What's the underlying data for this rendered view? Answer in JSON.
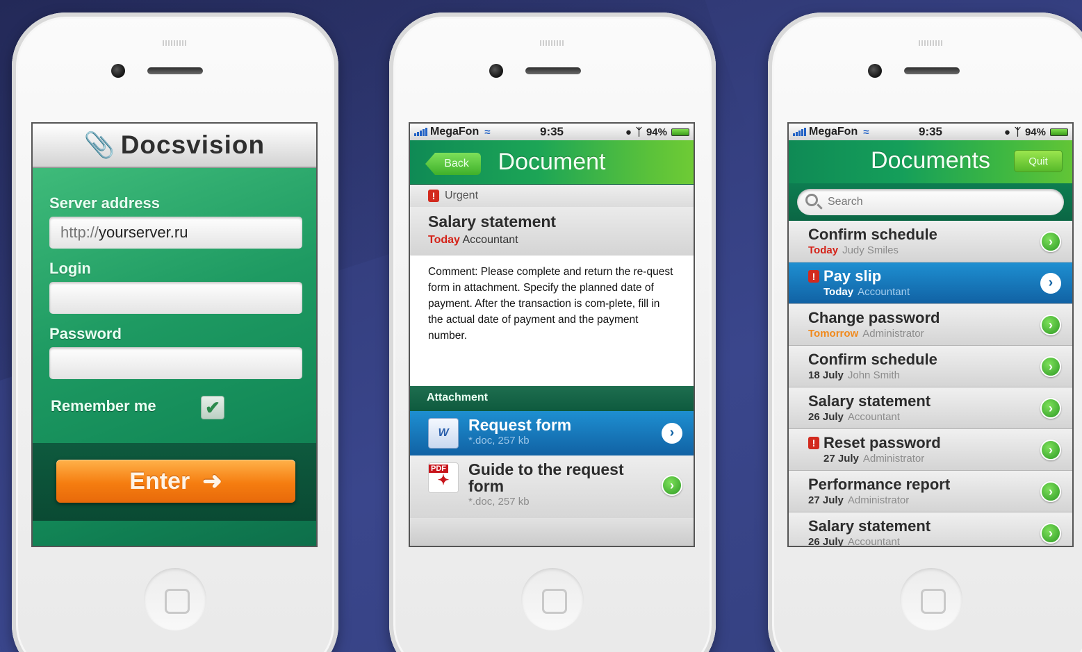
{
  "status": {
    "carrier": "MegaFon",
    "time": "9:35",
    "battery": "94%"
  },
  "login": {
    "brand": "Docsvision",
    "server_label": "Server address",
    "server_prefix": "http://",
    "server_value": "yourserver.ru",
    "login_label": "Login",
    "login_value": "",
    "password_label": "Password",
    "password_value": "",
    "remember_label": "Remember me",
    "remember_checked": true,
    "enter_label": "Enter"
  },
  "document": {
    "nav_title": "Document",
    "back_label": "Back",
    "urgent_label": "Urgent",
    "title": "Salary statement",
    "date": "Today",
    "author": "Accountant",
    "comment": "Comment: Please complete and return the re-quest form in attachment. Specify the planned date of payment. After the transaction is com-plete, fill in the actual date of payment and the payment number.",
    "attachment_header": "Attachment",
    "attachments": [
      {
        "title": "Request form",
        "meta": "*.doc, 257 kb",
        "icon": "word-icon",
        "selected": true
      },
      {
        "title": "Guide to the request form",
        "meta": "*.doc, 257 kb",
        "icon": "pdf-icon",
        "selected": false
      }
    ]
  },
  "documents": {
    "nav_title": "Documents",
    "quit_label": "Quit",
    "search_placeholder": "Search",
    "items": [
      {
        "title": "Confirm schedule",
        "date": "Today",
        "author": "Judy Smiles",
        "urgent": false,
        "date_color": "red",
        "selected": false
      },
      {
        "title": "Pay slip",
        "date": "Today",
        "author": "Accountant",
        "urgent": true,
        "date_color": "white",
        "selected": true
      },
      {
        "title": "Change password",
        "date": "Tomorrow",
        "author": "Administrator",
        "urgent": false,
        "date_color": "orange",
        "selected": false
      },
      {
        "title": "Confirm schedule",
        "date": "18 July",
        "author": "John Smith",
        "urgent": false,
        "date_color": "dark",
        "selected": false
      },
      {
        "title": "Salary statement",
        "date": "26 July",
        "author": "Accountant",
        "urgent": false,
        "date_color": "dark",
        "selected": false
      },
      {
        "title": "Reset password",
        "date": "27 July",
        "author": "Administrator",
        "urgent": true,
        "date_color": "dark",
        "selected": false
      },
      {
        "title": "Performance report",
        "date": "27 July",
        "author": "Administrator",
        "urgent": false,
        "date_color": "dark",
        "selected": false
      },
      {
        "title": "Salary statement",
        "date": "26 July",
        "author": "Accountant",
        "urgent": false,
        "date_color": "dark",
        "selected": false
      }
    ]
  },
  "colors": {
    "background": "#343e7e",
    "brand_green": "#1ca556",
    "selected_blue": "#1162a4",
    "enter_orange": "#f57d10",
    "urgent_red": "#d22a1e"
  }
}
